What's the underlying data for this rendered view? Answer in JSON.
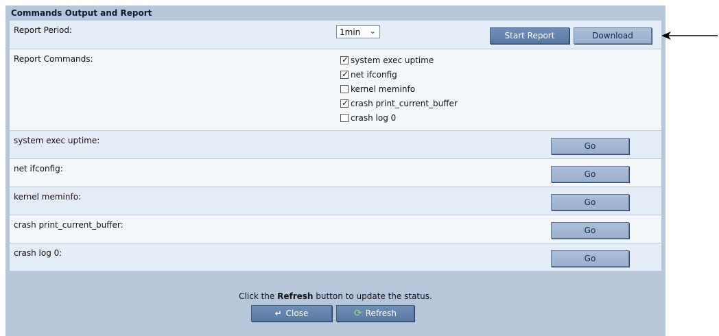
{
  "panel": {
    "title": "Commands Output and Report"
  },
  "report_period": {
    "label": "Report Period:",
    "selected": "1min",
    "start_button": "Start Report",
    "download_button": "Download"
  },
  "report_commands": {
    "label": "Report Commands:",
    "items": [
      {
        "label": "system exec uptime",
        "checked": true
      },
      {
        "label": "net ifconfig",
        "checked": true
      },
      {
        "label": "kernel meminfo",
        "checked": false
      },
      {
        "label": "crash print_current_buffer",
        "checked": true
      },
      {
        "label": "crash log 0",
        "checked": false
      }
    ]
  },
  "commands": [
    {
      "label": "system exec uptime:",
      "button": "Go"
    },
    {
      "label": "net ifconfig:",
      "button": "Go"
    },
    {
      "label": "kernel meminfo:",
      "button": "Go"
    },
    {
      "label": "crash print_current_buffer:",
      "button": "Go"
    },
    {
      "label": "crash log 0:",
      "button": "Go"
    }
  ],
  "footer": {
    "status_prefix": "Click the ",
    "status_bold": "Refresh",
    "status_suffix": " button to update the status.",
    "close_button": "Close",
    "refresh_button": "Refresh"
  }
}
